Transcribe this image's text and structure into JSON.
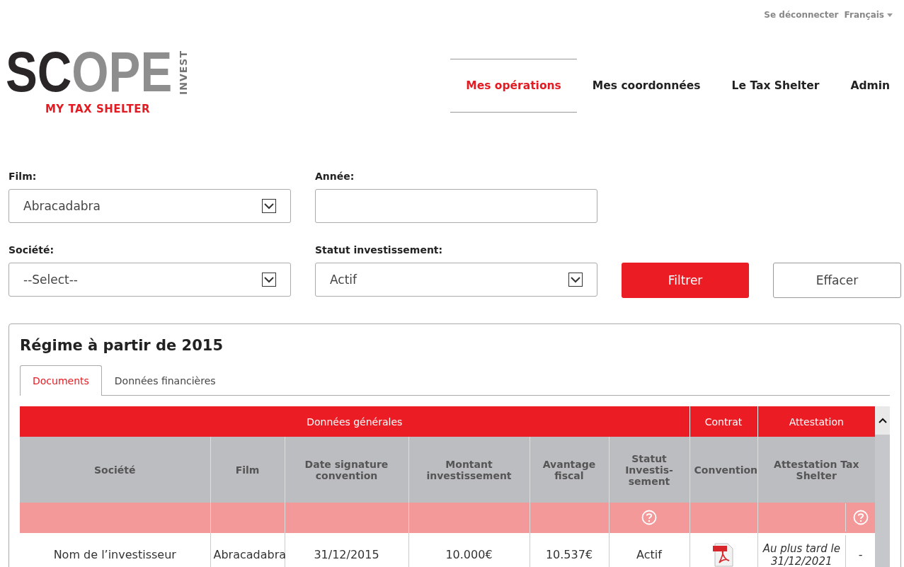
{
  "top_links": [
    {
      "label": "Se déconnecter",
      "kind": "link"
    },
    {
      "label": "Français",
      "kind": "dropdown"
    }
  ],
  "logo": {
    "wordmark": "SCOPE",
    "side": "INVEST",
    "tagline": "MY TAX SHELTER"
  },
  "nav": [
    {
      "label": "Mes opérations",
      "selected": true
    },
    {
      "label": "Mes coordonnées",
      "selected": false
    },
    {
      "label": "Le Tax Shelter",
      "selected": false
    },
    {
      "label": "Admin",
      "selected": false
    }
  ],
  "filters": [
    {
      "label": "Film:",
      "kind": "select",
      "value": "Abracadabra"
    },
    {
      "label": "Année:",
      "kind": "input"
    },
    {
      "label": "Société:",
      "kind": "select",
      "value": "--Select--"
    },
    {
      "label": "Statut investissement:",
      "kind": "select",
      "value": "Actif"
    }
  ],
  "buttons": [
    {
      "label": "Filtrer",
      "kind": "primary"
    },
    {
      "label": "Effacer",
      "kind": "secondary"
    }
  ],
  "panel": {
    "title": "Régime à partir de 2015",
    "tabs": [
      {
        "label": "Documents",
        "selected": true
      },
      {
        "label": "Données financières",
        "selected": false
      }
    ],
    "table": {
      "groups": [
        {
          "label": "Données générales"
        },
        {
          "label": "Contrat"
        },
        {
          "label": "Attestation"
        }
      ],
      "columns": [
        {
          "label": "Société"
        },
        {
          "label": "Film"
        },
        {
          "label": "Date signature convention"
        },
        {
          "label": "Montant investissement"
        },
        {
          "label": "Avantage fiscal"
        },
        {
          "label": "Statut Investis-sement"
        },
        {
          "label": "Convention"
        },
        {
          "label": "Attestation Tax Shelter"
        }
      ],
      "filter_row": [
        {
          "kind": "empty"
        },
        {
          "kind": "empty"
        },
        {
          "kind": "empty"
        },
        {
          "kind": "empty"
        },
        {
          "kind": "empty"
        },
        {
          "kind": "help"
        },
        {
          "kind": "empty"
        },
        {
          "kind": "split_help"
        }
      ],
      "rows": [
        [
          {
            "kind": "text",
            "text": "Nom de l’investisseur"
          },
          {
            "kind": "text",
            "text": "Abracadabra"
          },
          {
            "kind": "text",
            "text": "31/12/2015"
          },
          {
            "kind": "text",
            "text": "10.000€"
          },
          {
            "kind": "text",
            "text": "10.537€"
          },
          {
            "kind": "text",
            "text": "Actif"
          },
          {
            "kind": "pdf"
          },
          {
            "kind": "split_note",
            "text": "Au plus tard le 31/12/2021",
            "side": "-"
          }
        ]
      ]
    }
  }
}
